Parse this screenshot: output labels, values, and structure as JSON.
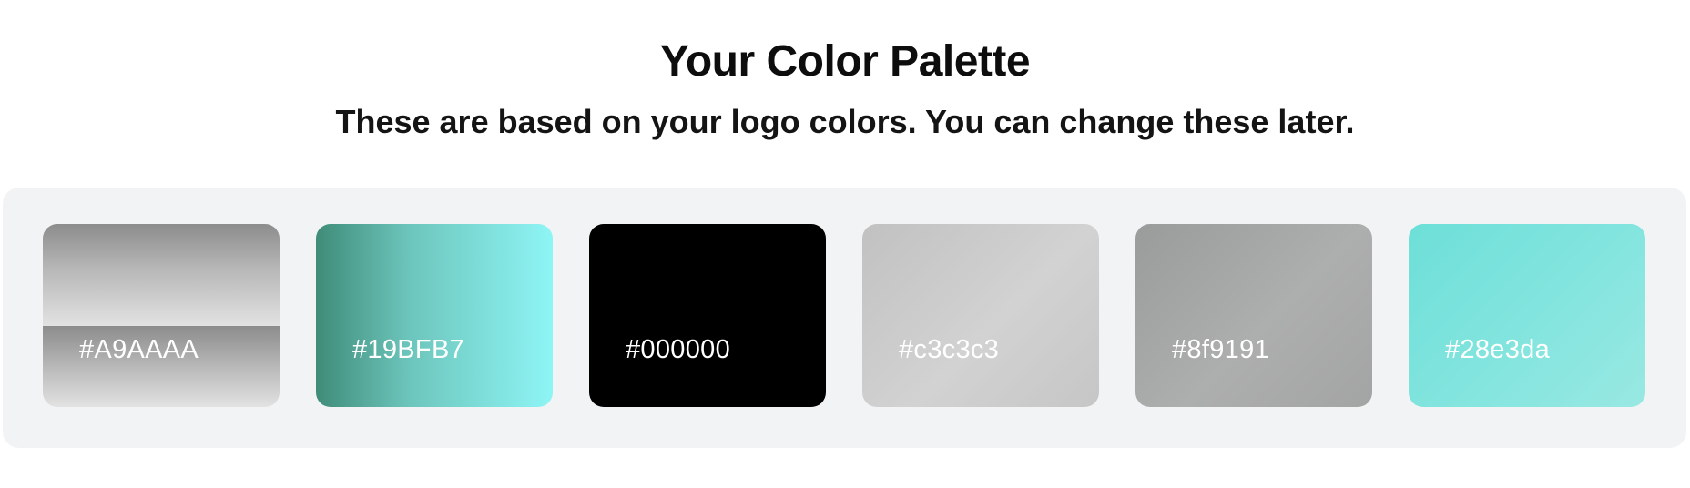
{
  "header": {
    "title": "Your Color Palette",
    "subtitle": "These are based on your logo colors. You can change these later."
  },
  "palette": {
    "swatches": [
      {
        "label": "#A9AAAA",
        "color": "#A9AAAA"
      },
      {
        "label": "#19BFB7",
        "color": "#19BFB7"
      },
      {
        "label": "#000000",
        "color": "#000000"
      },
      {
        "label": "#c3c3c3",
        "color": "#c3c3c3"
      },
      {
        "label": "#8f9191",
        "color": "#8f9191"
      },
      {
        "label": "#28e3da",
        "color": "#28e3da"
      }
    ]
  }
}
